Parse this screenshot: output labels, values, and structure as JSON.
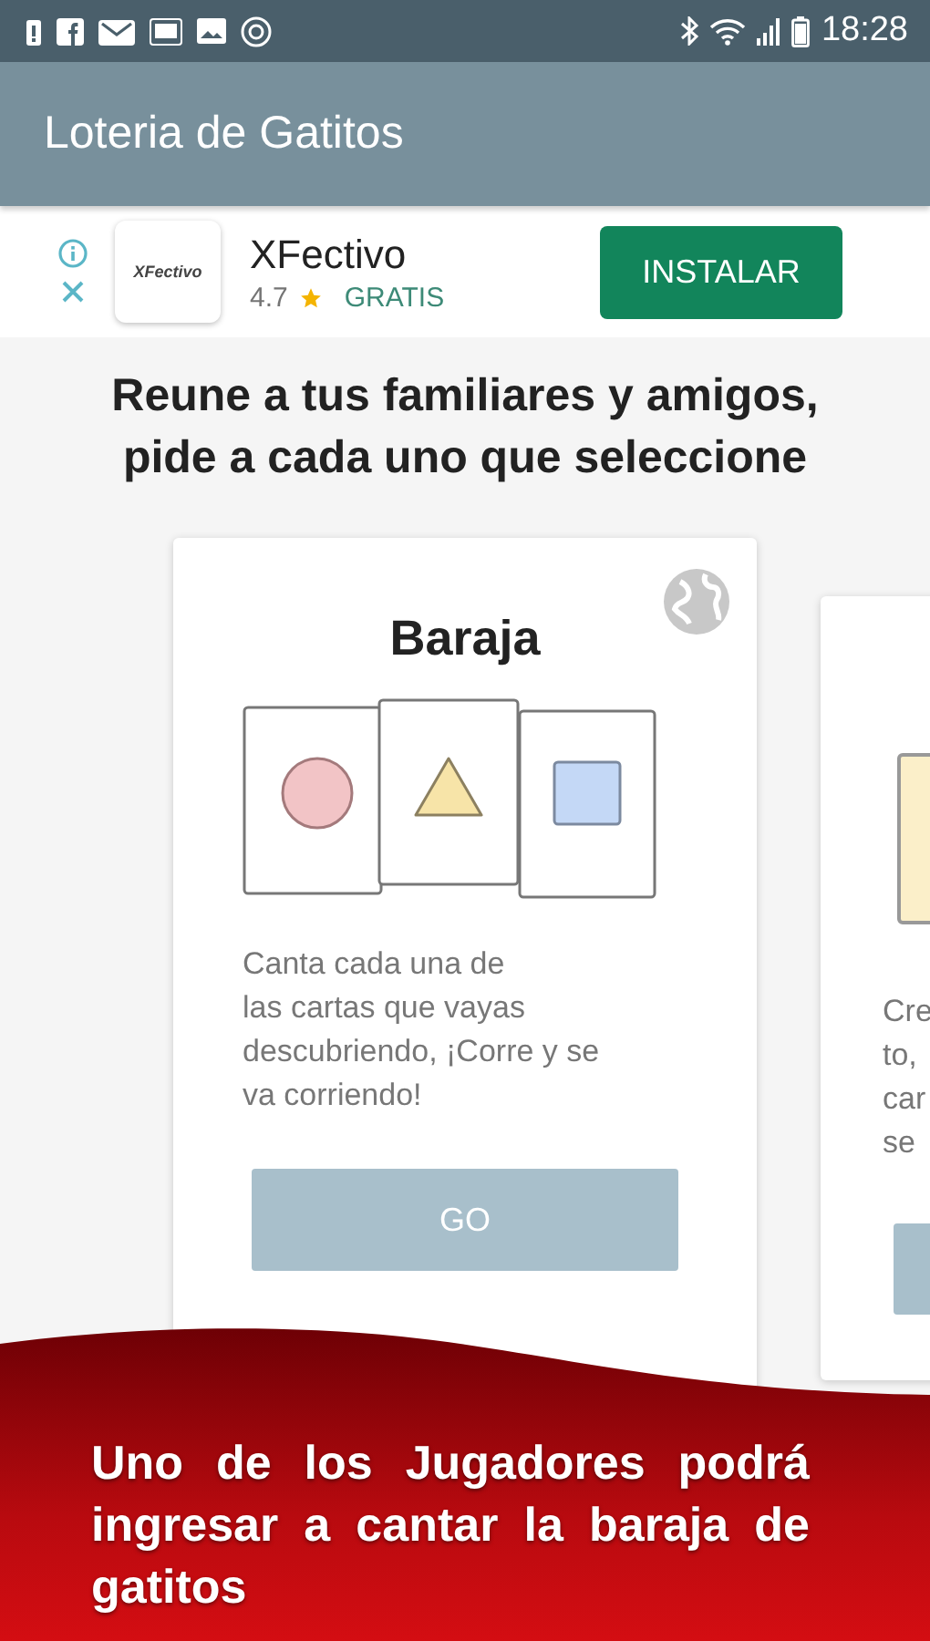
{
  "status_bar": {
    "time": "18:28"
  },
  "app_bar": {
    "title": "Loteria de Gatitos"
  },
  "ad": {
    "logo_text": "XFectivo",
    "app_name": "XFectivo",
    "rating": "4.7",
    "price": "GRATIS",
    "button": "INSTALAR"
  },
  "heading": "Reune a tus familiares y amigos, pide a cada uno que seleccione",
  "cards": [
    {
      "kind": "full",
      "title": "Baraja",
      "description_lines": [
        "Canta cada una de",
        "las cartas que vayas",
        "descubriendo, ¡Corre y se",
        "va corriendo!"
      ],
      "button": "GO"
    },
    {
      "kind": "partial",
      "description_lines": [
        "Cre",
        "to,",
        "car",
        "se"
      ]
    }
  ],
  "banner": {
    "text": "Uno de los Jugadores podrá ingresar a cantar la baraja de gatitos"
  }
}
